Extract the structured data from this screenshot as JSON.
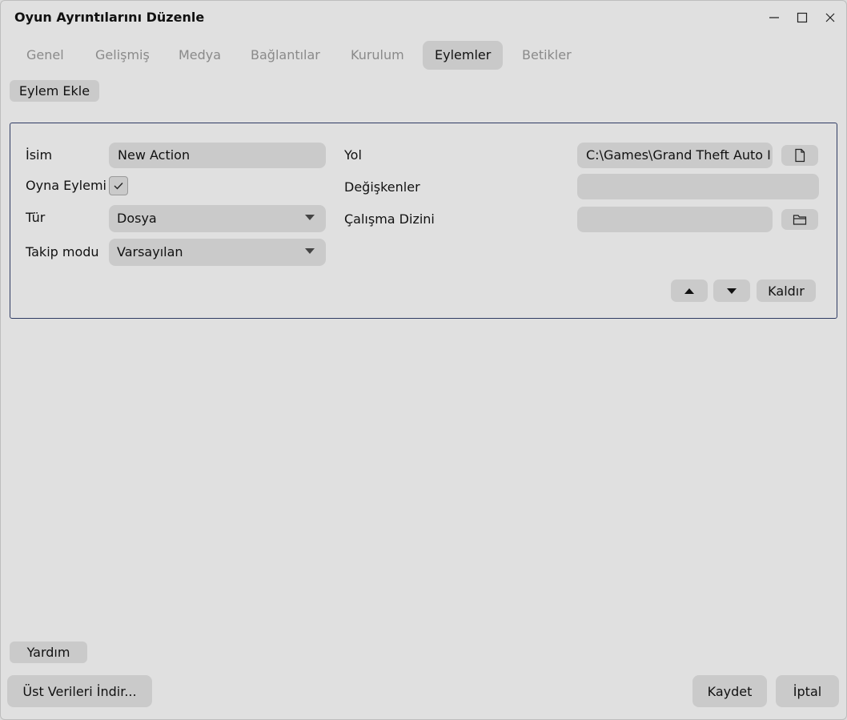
{
  "window": {
    "title": "Oyun Ayrıntılarını Düzenle",
    "controls": [
      "minimize-icon",
      "maximize-icon",
      "close-icon"
    ]
  },
  "tabs": [
    {
      "label": "Genel",
      "active": false
    },
    {
      "label": "Gelişmiş",
      "active": false
    },
    {
      "label": "Medya",
      "active": false
    },
    {
      "label": "Bağlantılar",
      "active": false
    },
    {
      "label": "Kurulum",
      "active": false
    },
    {
      "label": "Eylemler",
      "active": true
    },
    {
      "label": "Betikler",
      "active": false
    }
  ],
  "toolbar": {
    "add_action_label": "Eylem Ekle"
  },
  "action": {
    "name_label": "İsim",
    "name_value": "New Action",
    "play_action_label": "Oyna Eylemi",
    "play_action_checked": true,
    "type_label": "Tür",
    "type_value": "Dosya",
    "tracking_label": "Takip modu",
    "tracking_value": "Varsayılan",
    "path_label": "Yol",
    "path_value": "C:\\Games\\Grand Theft Auto I",
    "path_icon": "file-icon",
    "args_label": "Değişkenler",
    "args_value": "",
    "workdir_label": "Çalışma Dizini",
    "workdir_value": "",
    "workdir_icon": "folder-icon",
    "move_up_icon": "triangle-up-icon",
    "move_down_icon": "triangle-down-icon",
    "remove_label": "Kaldır"
  },
  "footer": {
    "help_label": "Yardım",
    "download_metadata_label": "Üst Verileri İndir...",
    "save_label": "Kaydet",
    "cancel_label": "İptal"
  }
}
